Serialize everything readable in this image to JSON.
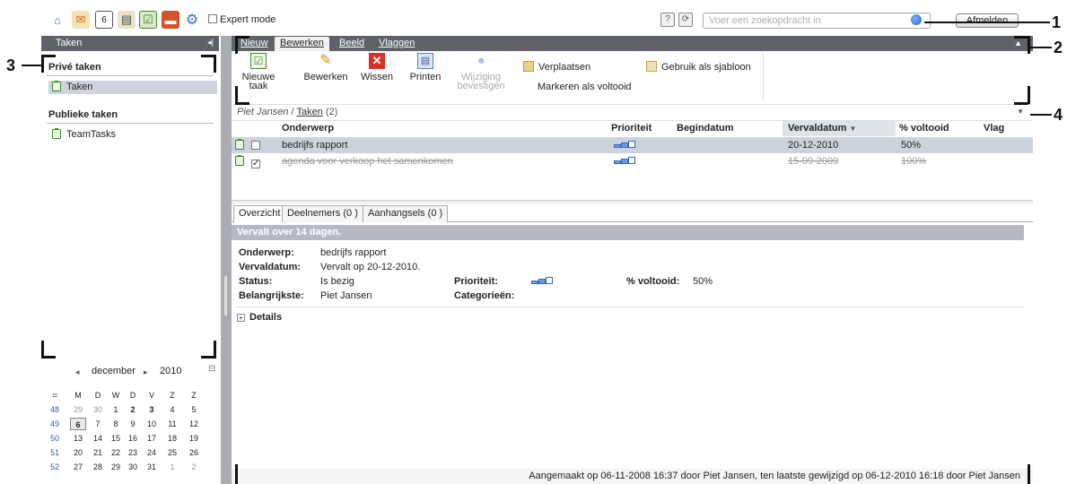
{
  "topbar": {
    "app_icons": [
      "home-icon",
      "contacts-icon",
      "calendar-icon",
      "notes-icon",
      "tasks-icon",
      "briefcase-icon",
      "settings-icon"
    ],
    "expert_mode_label": "Expert mode",
    "search_placeholder": "Voer een zoekopdracht in",
    "help_label": "?",
    "refresh_label": "⟳",
    "logout_label": "Afmelden"
  },
  "left": {
    "header": "Taken",
    "private_section": "Privé taken",
    "private_item": "Taken",
    "public_section": "Publieke taken",
    "public_item": "TeamTasks"
  },
  "calendar": {
    "month": "december",
    "year": "2010",
    "weekday_headers": [
      "M",
      "D",
      "W",
      "D",
      "V",
      "Z",
      "Z"
    ],
    "weeks": [
      {
        "wk": "48",
        "days": [
          "29",
          "30",
          "1",
          "2",
          "3",
          "4",
          "5"
        ]
      },
      {
        "wk": "49",
        "days": [
          "6",
          "7",
          "8",
          "9",
          "10",
          "11",
          "12"
        ]
      },
      {
        "wk": "50",
        "days": [
          "13",
          "14",
          "15",
          "16",
          "17",
          "18",
          "19"
        ]
      },
      {
        "wk": "51",
        "days": [
          "20",
          "21",
          "22",
          "23",
          "24",
          "25",
          "26"
        ]
      },
      {
        "wk": "52",
        "days": [
          "27",
          "28",
          "29",
          "30",
          "31",
          "1",
          "2"
        ]
      }
    ],
    "today": "6"
  },
  "ribbon": {
    "tabs": [
      "Nieuw",
      "Bewerken",
      "Beeld",
      "Vlaggen"
    ],
    "active_tab": "Bewerken",
    "new_task_line1": "Nieuwe",
    "new_task_line2": "taak",
    "edit": "Bewerken",
    "delete": "Wissen",
    "print": "Printen",
    "confirm_line1": "Wijziging",
    "confirm_line2": "bevestigen",
    "move": "Verplaatsen",
    "mark_done": "Markeren als voltooid",
    "use_template": "Gebruik als sjabloon"
  },
  "breadcrumb": {
    "user": "Piet Jansen",
    "sep": " / ",
    "folder": "Taken",
    "count": " (2)"
  },
  "grid": {
    "columns": [
      "Onderwerp",
      "Prioriteit",
      "Begindatum",
      "Vervaldatum",
      "% voltooid",
      "Vlag"
    ],
    "sorted_column": "Vervaldatum",
    "rows": [
      {
        "subject": "bedrijfs rapport",
        "due": "20-12-2010",
        "percent": "50%",
        "checked": false
      },
      {
        "subject": "agenda voor verkoop het samenkomen",
        "due": "15-09-2009",
        "percent": "100%",
        "checked": true
      }
    ]
  },
  "detail": {
    "tabs": [
      "Overzicht",
      "Deelnemers  (0 )",
      "Aanhangsels  (0 )"
    ],
    "banner": "Vervalt over 14 dagen.",
    "labels": {
      "subject": "Onderwerp:",
      "due": "Vervaldatum:",
      "status": "Status:",
      "stakeholder": "Belangrijkste:",
      "priority": "Prioriteit:",
      "categories": "Categorieën:",
      "percent": "% voltooid:"
    },
    "values": {
      "subject": "bedrijfs rapport",
      "due": "Vervalt op 20-12-2010.",
      "status": "Is bezig",
      "stakeholder": "Piet Jansen",
      "percent": "50%"
    },
    "details_label": "Details"
  },
  "footer": "Aangemaakt op 06-11-2008 16:37 door Piet Jansen, ten laatste gewijzigd op 06-12-2010 16:18 door Piet Jansen",
  "callouts": [
    "1",
    "2",
    "3",
    "4"
  ],
  "colors": {
    "header_bg": "#5f6367",
    "selected_row": "#cdd3dc",
    "banner": "#b5bac2",
    "task_green": "#3a8a2a"
  }
}
